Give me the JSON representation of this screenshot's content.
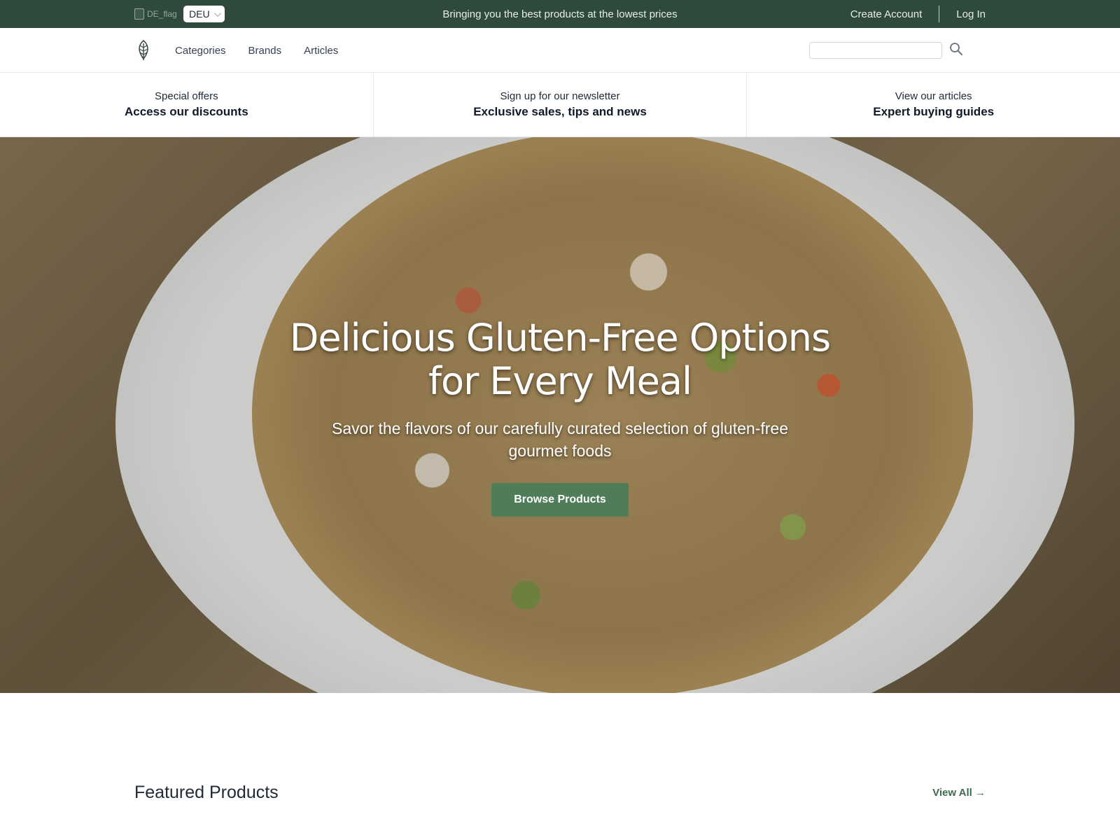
{
  "topbar": {
    "flag_alt": "DE_flag",
    "language": "DEU",
    "announcement": "Bringing you the best products at the lowest prices",
    "create_account": "Create Account",
    "log_in": "Log In"
  },
  "nav": {
    "links": [
      "Categories",
      "Brands",
      "Articles"
    ],
    "search_placeholder": ""
  },
  "promos": [
    {
      "small": "Special offers",
      "big": "Access our discounts"
    },
    {
      "small": "Sign up for our newsletter",
      "big": "Exclusive sales, tips and news"
    },
    {
      "small": "View our articles",
      "big": "Expert buying guides"
    }
  ],
  "hero": {
    "title_line1": "Delicious Gluten-Free Options",
    "title_line2": "for Every Meal",
    "subtitle": "Savor the flavors of our carefully curated selection of gluten-free gourmet foods",
    "cta": "Browse Products"
  },
  "featured": {
    "title": "Featured Products",
    "view_all": "View All →"
  },
  "colors": {
    "topbar_bg": "#2f4a3c",
    "cta_bg": "#4f7d5a",
    "link_green": "#3f6b4c"
  },
  "icons": [
    "broken-image-icon",
    "chevron-down-icon",
    "leaf-logo-icon",
    "search-icon"
  ]
}
